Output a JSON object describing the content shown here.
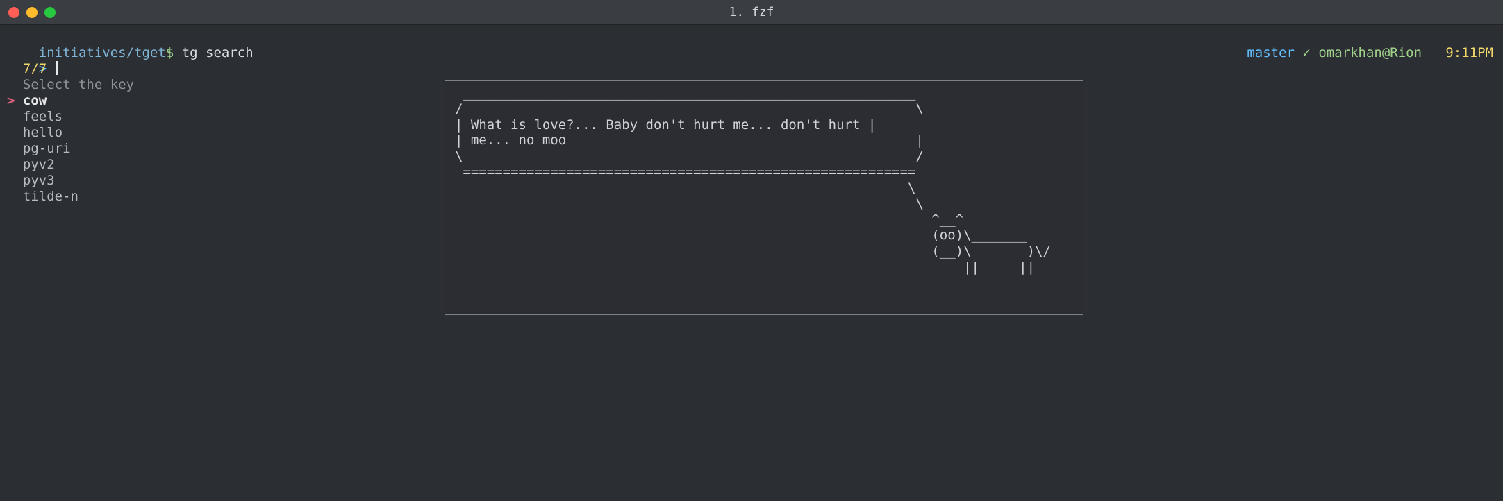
{
  "window": {
    "title": "1. fzf"
  },
  "prompt": {
    "path": "initiatives/tget",
    "dollar": "$",
    "command": "tg search"
  },
  "status": {
    "branch": "master",
    "check": "✓",
    "user_host": "omarkhan@Rion",
    "time": "9:11PM"
  },
  "fzf": {
    "query_prefix": ">",
    "query": "",
    "count": "7/7",
    "header": "Select the key",
    "pointer": ">",
    "items": [
      "cow",
      "feels",
      "hello",
      "pg-uri",
      "pyv2",
      "pyv3",
      "tilde-n"
    ],
    "selected_index": 0,
    "preview": " _________________________________________________________\n/                                                         \\\n| What is love?... Baby don't hurt me... don't hurt |\n| me... no moo                                            |\n\\                                                         /\n =========================================================\n                                                         \\\n                                                          \\\n                                                            ^__^\n                                                            (oo)\\_______\n                                                            (__)\\       )\\/\n                                                                ||     ||"
  }
}
